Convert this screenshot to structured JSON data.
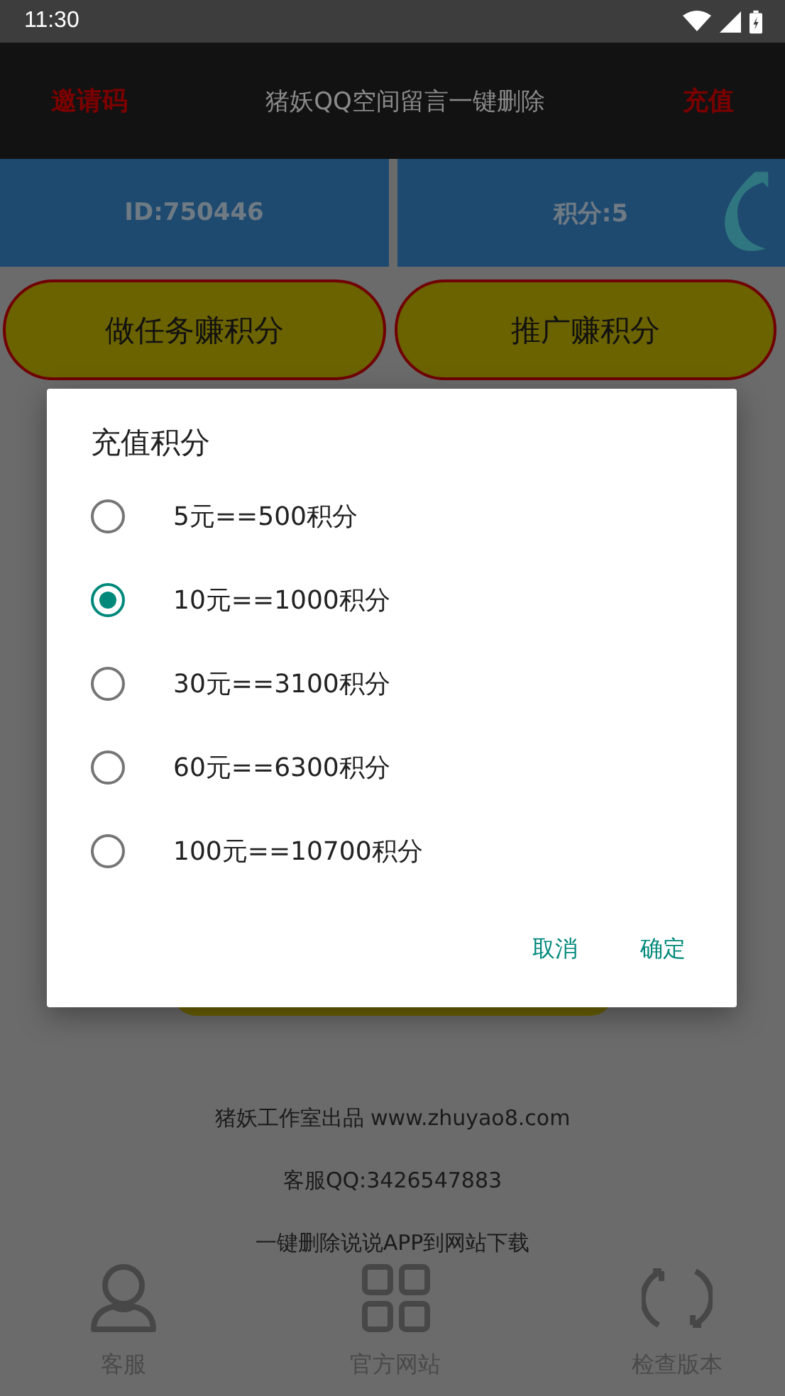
{
  "status_bar": {
    "time": "11:30"
  },
  "app_bar": {
    "left_action": "邀请码",
    "title": "猪妖QQ空间留言一键删除",
    "right_action": "充值"
  },
  "account": {
    "id": "ID:750446",
    "points": "积分:5"
  },
  "action_buttons": [
    "做任务赚积分",
    "推广赚积分"
  ],
  "dialog": {
    "title": "充值积分",
    "options": [
      {
        "label": "5元==500积分",
        "selected": false
      },
      {
        "label": "10元==1000积分",
        "selected": true
      },
      {
        "label": "30元==3100积分",
        "selected": false
      },
      {
        "label": "60元==6300积分",
        "selected": false
      },
      {
        "label": "100元==10700积分",
        "selected": false
      }
    ],
    "buttons": [
      "取消",
      "确定"
    ]
  },
  "footer": [
    "猪妖工作室出品 www.zhuyao8.com",
    "客服QQ:3426547883",
    "一键删除说说APP到网站下载"
  ],
  "bottom_nav": [
    {
      "label": "客服",
      "kind": "person"
    },
    {
      "label": "官方网站",
      "kind": "grid"
    },
    {
      "label": "检查版本",
      "kind": "refresh"
    }
  ]
}
